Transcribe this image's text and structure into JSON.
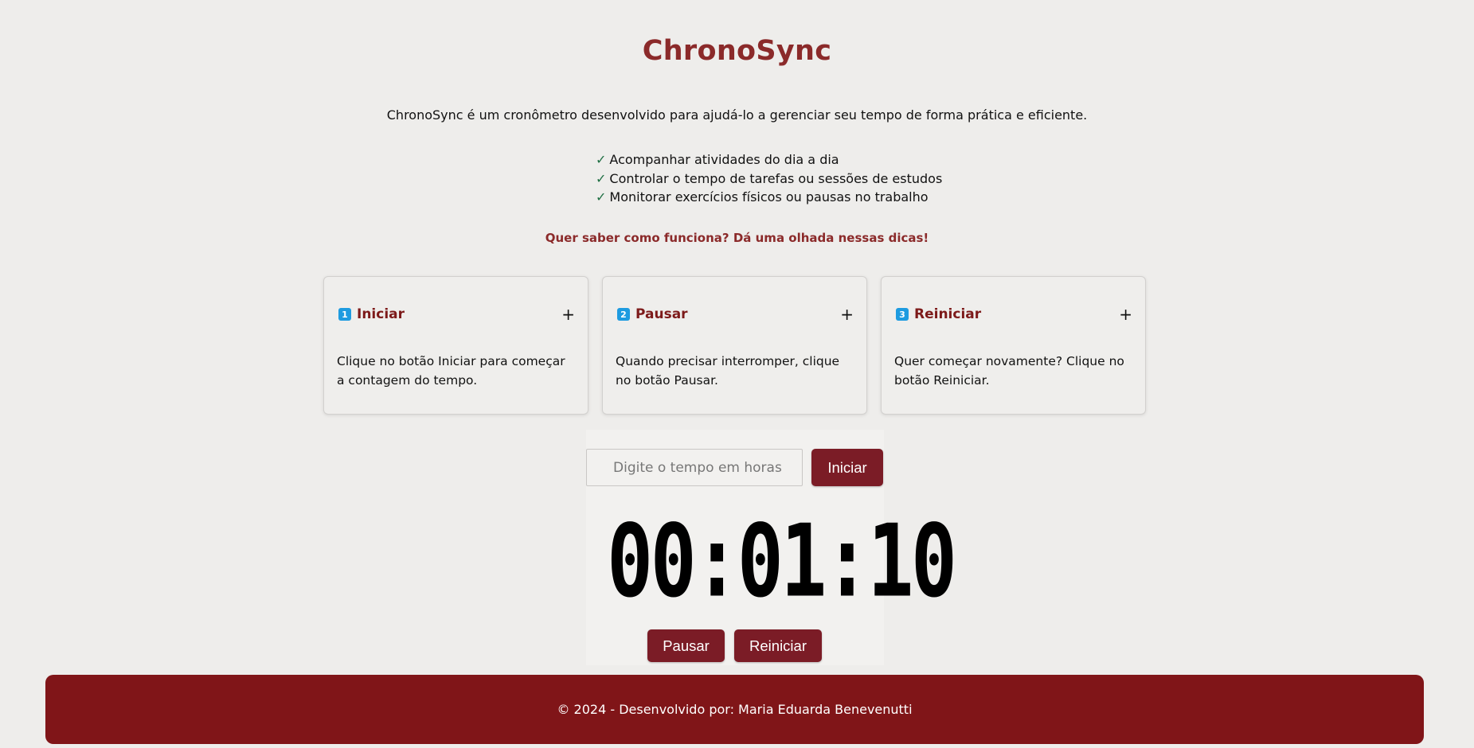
{
  "app": {
    "title": "ChronoSync",
    "intro": "ChronoSync é um cronômetro desenvolvido para ajudá-lo a gerenciar seu tempo de forma prática e eficiente."
  },
  "features": [
    {
      "check": "✓",
      "text": "Acompanhar atividades do dia a dia"
    },
    {
      "check": "✓",
      "text": "Controlar o tempo de tarefas ou sessões de estudos"
    },
    {
      "check": "✓",
      "text": "Monitorar exercícios físicos ou pausas no trabalho"
    }
  ],
  "tips_cta": "Quer saber como funciona? Dá uma olhada nessas dicas!",
  "cards": [
    {
      "number": "1",
      "title": "Iniciar",
      "expand": "+",
      "body": "Clique no botão Iniciar para começar a contagem do tempo."
    },
    {
      "number": "2",
      "title": "Pausar",
      "expand": "+",
      "body": "Quando precisar interromper, clique no botão Pausar."
    },
    {
      "number": "3",
      "title": "Reiniciar",
      "expand": "+",
      "body": "Quer começar novamente? Clique no botão Reiniciar."
    }
  ],
  "timer": {
    "input_placeholder": "Digite o tempo em horas",
    "input_value": "",
    "start_label": "Iniciar",
    "display": "00:01:10",
    "pause_label": "Pausar",
    "reset_label": "Reiniciar"
  },
  "footer": {
    "text": "© 2024 - Desenvolvido por: Maria Eduarda Benevenutti"
  },
  "colors": {
    "background": "#eeedeb",
    "accent": "#8b2a2a",
    "button": "#7b1c26",
    "footer": "#801518",
    "badge": "#1e9be0"
  }
}
